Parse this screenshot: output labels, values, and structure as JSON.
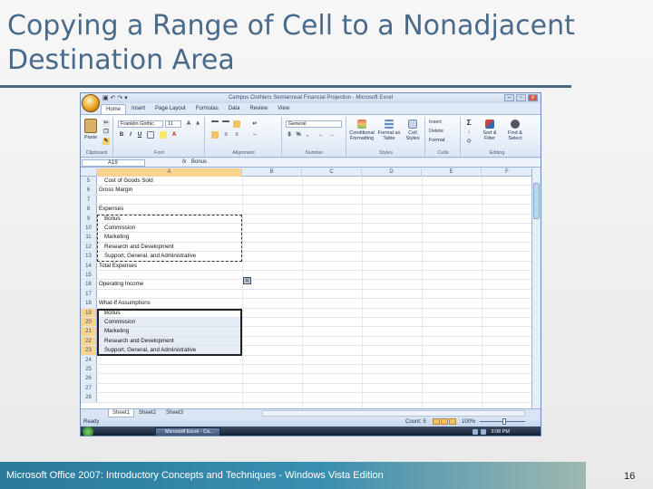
{
  "slide": {
    "title": "Copying a Range of Cell to a Nonadjacent Destination Area",
    "footer": "Microsoft Office 2007: Introductory Concepts and Techniques - Windows Vista Edition",
    "page_number": "16"
  },
  "excel": {
    "window_title": "Campus Clothiers Semiannual Financial Projection - Microsoft Excel",
    "qat": "▣ ↶ ↷ ▾",
    "window_controls": [
      "–",
      "▫",
      "x"
    ],
    "tabs": [
      "Home",
      "Insert",
      "Page Layout",
      "Formulas",
      "Data",
      "Review",
      "View"
    ],
    "ribbon": {
      "paste_label": "Paste",
      "font_name": "Franklin Gothic",
      "font_size": "11",
      "number_format": "General",
      "conditional_formatting": "Conditional Formatting",
      "format_as_table": "Format as Table",
      "cell_styles": "Cell Styles",
      "insert": "Insert",
      "delete": "Delete",
      "format": "Format",
      "sort_filter": "Sort & Filter",
      "find_select": "Find & Select",
      "groups": [
        "Clipboard",
        "Font",
        "Alignment",
        "Number",
        "Styles",
        "Cells",
        "Editing"
      ]
    },
    "formula_bar": {
      "name_box": "A19",
      "fx": "fx",
      "content": "Bonus"
    },
    "columns": [
      "A",
      "B",
      "C",
      "D",
      "E",
      "F"
    ],
    "rows": [
      {
        "num": "5",
        "text": "Cost of Goods Sold",
        "indent": true
      },
      {
        "num": "6",
        "text": "Gross Margin",
        "indent": false
      },
      {
        "num": "7",
        "text": "",
        "indent": false
      },
      {
        "num": "8",
        "text": "Expenses",
        "indent": false
      },
      {
        "num": "9",
        "text": "Bonus",
        "indent": true
      },
      {
        "num": "10",
        "text": "Commission",
        "indent": true
      },
      {
        "num": "11",
        "text": "Marketing",
        "indent": true
      },
      {
        "num": "12",
        "text": "Research and Development",
        "indent": true
      },
      {
        "num": "13",
        "text": "Support, General, and Administrative",
        "indent": true
      },
      {
        "num": "14",
        "text": "Total Expenses",
        "indent": false
      },
      {
        "num": "15",
        "text": "",
        "indent": false
      },
      {
        "num": "16",
        "text": "Operating Income",
        "indent": false
      },
      {
        "num": "17",
        "text": "",
        "indent": false
      },
      {
        "num": "18",
        "text": "What-If Assumptions",
        "indent": false
      },
      {
        "num": "19",
        "text": "Bonus",
        "indent": true
      },
      {
        "num": "20",
        "text": "Commission",
        "indent": true
      },
      {
        "num": "21",
        "text": "Marketing",
        "indent": true
      },
      {
        "num": "22",
        "text": "Research and Development",
        "indent": true
      },
      {
        "num": "23",
        "text": "Support, General, and Administrative",
        "indent": true
      },
      {
        "num": "24",
        "text": "",
        "indent": false
      },
      {
        "num": "25",
        "text": "",
        "indent": false
      },
      {
        "num": "26",
        "text": "",
        "indent": false
      },
      {
        "num": "27",
        "text": "",
        "indent": false
      },
      {
        "num": "28",
        "text": "",
        "indent": false
      }
    ],
    "sheet_tabs": [
      "Sheet1",
      "Sheet2",
      "Sheet3"
    ],
    "status": {
      "ready": "Ready",
      "count": "Count: 5",
      "zoom": "100%"
    },
    "taskbar": {
      "item": "Microsoft Excel - Ca...",
      "clock": "3:08 PM"
    }
  }
}
